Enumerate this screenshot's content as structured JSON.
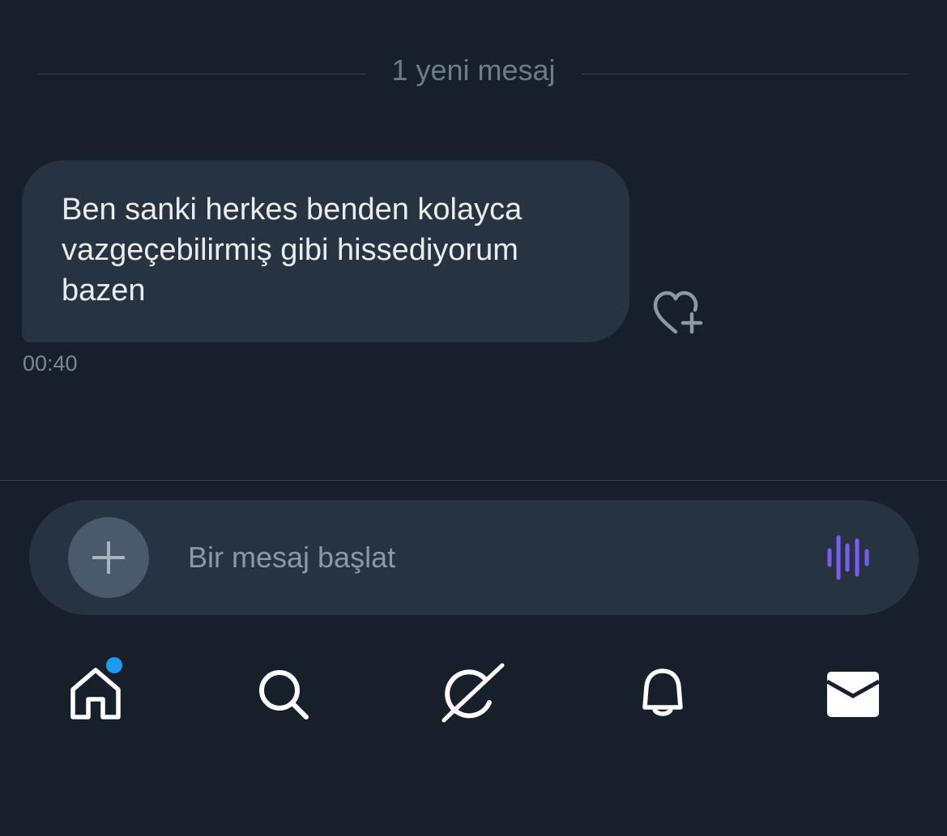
{
  "divider": {
    "label": "1 yeni mesaj"
  },
  "message": {
    "text": "Ben sanki herkes benden kolayca\nvazgeçebilirmiş gibi hissediyorum\nbazen",
    "time": "00:40",
    "react_icon": "heart-plus-icon"
  },
  "composer": {
    "placeholder": "Bir mesaj başlat",
    "value": "",
    "add_icon": "plus-icon",
    "voice_icon": "voice-wave-icon"
  },
  "nav": {
    "items": [
      {
        "name": "home",
        "icon": "home-icon",
        "has_notification": true
      },
      {
        "name": "search",
        "icon": "search-icon"
      },
      {
        "name": "grok",
        "icon": "grok-icon"
      },
      {
        "name": "notifications",
        "icon": "bell-icon"
      },
      {
        "name": "messages",
        "icon": "mail-icon"
      }
    ]
  },
  "colors": {
    "background": "#171f2a",
    "bubble": "#273340",
    "accent_dot": "#1d9bf0",
    "voice_accent": "#7a5cf5"
  }
}
